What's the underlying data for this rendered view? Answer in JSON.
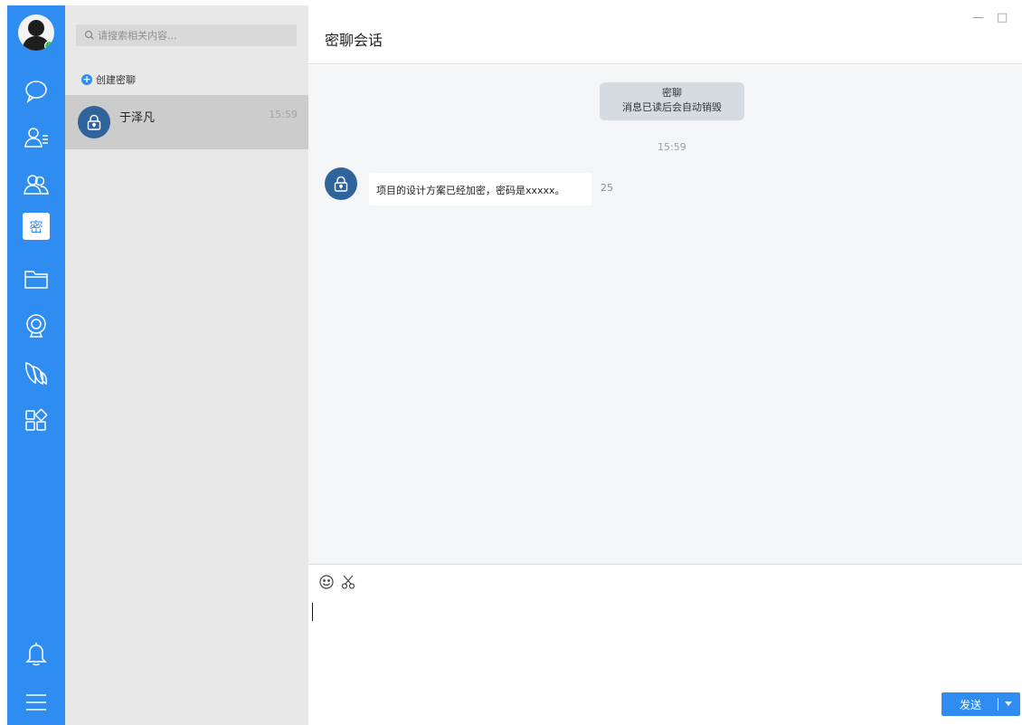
{
  "rail": {
    "items": [
      {
        "icon": "chat-bubble-icon"
      },
      {
        "icon": "contacts-icon"
      },
      {
        "icon": "group-icon"
      },
      {
        "icon": "secret-chat-icon",
        "label": "密"
      },
      {
        "icon": "folder-icon"
      },
      {
        "icon": "webcam-icon"
      },
      {
        "icon": "leaf-icon"
      },
      {
        "icon": "apps-icon"
      },
      {
        "icon": "bell-icon"
      },
      {
        "icon": "menu-icon"
      }
    ],
    "active": "secret-chat-icon",
    "accent": "#2f8cf0",
    "online_color": "#37c25a"
  },
  "list": {
    "search_placeholder": "请搜索相关内容...",
    "create_label": "创建密聊",
    "conversations": [
      {
        "name": "于泽凡",
        "time": "15:59",
        "icon": "lock-icon",
        "selected": true
      }
    ]
  },
  "chat": {
    "title": "密聊会话",
    "window_controls": {
      "minimize": "—",
      "maximize": "□"
    },
    "notice_title": "密聊",
    "notice_text": "消息已读后会自动销毁",
    "timestamp": "15:59",
    "messages": [
      {
        "text": "项目的设计方案已经加密，密码是xxxxx。",
        "read_countdown": "25",
        "avatar_icon": "lock-icon"
      }
    ],
    "toolbar": {
      "emoji_icon": "emoji-icon",
      "screenshot_icon": "scissors-icon"
    },
    "send_label": "发送"
  }
}
